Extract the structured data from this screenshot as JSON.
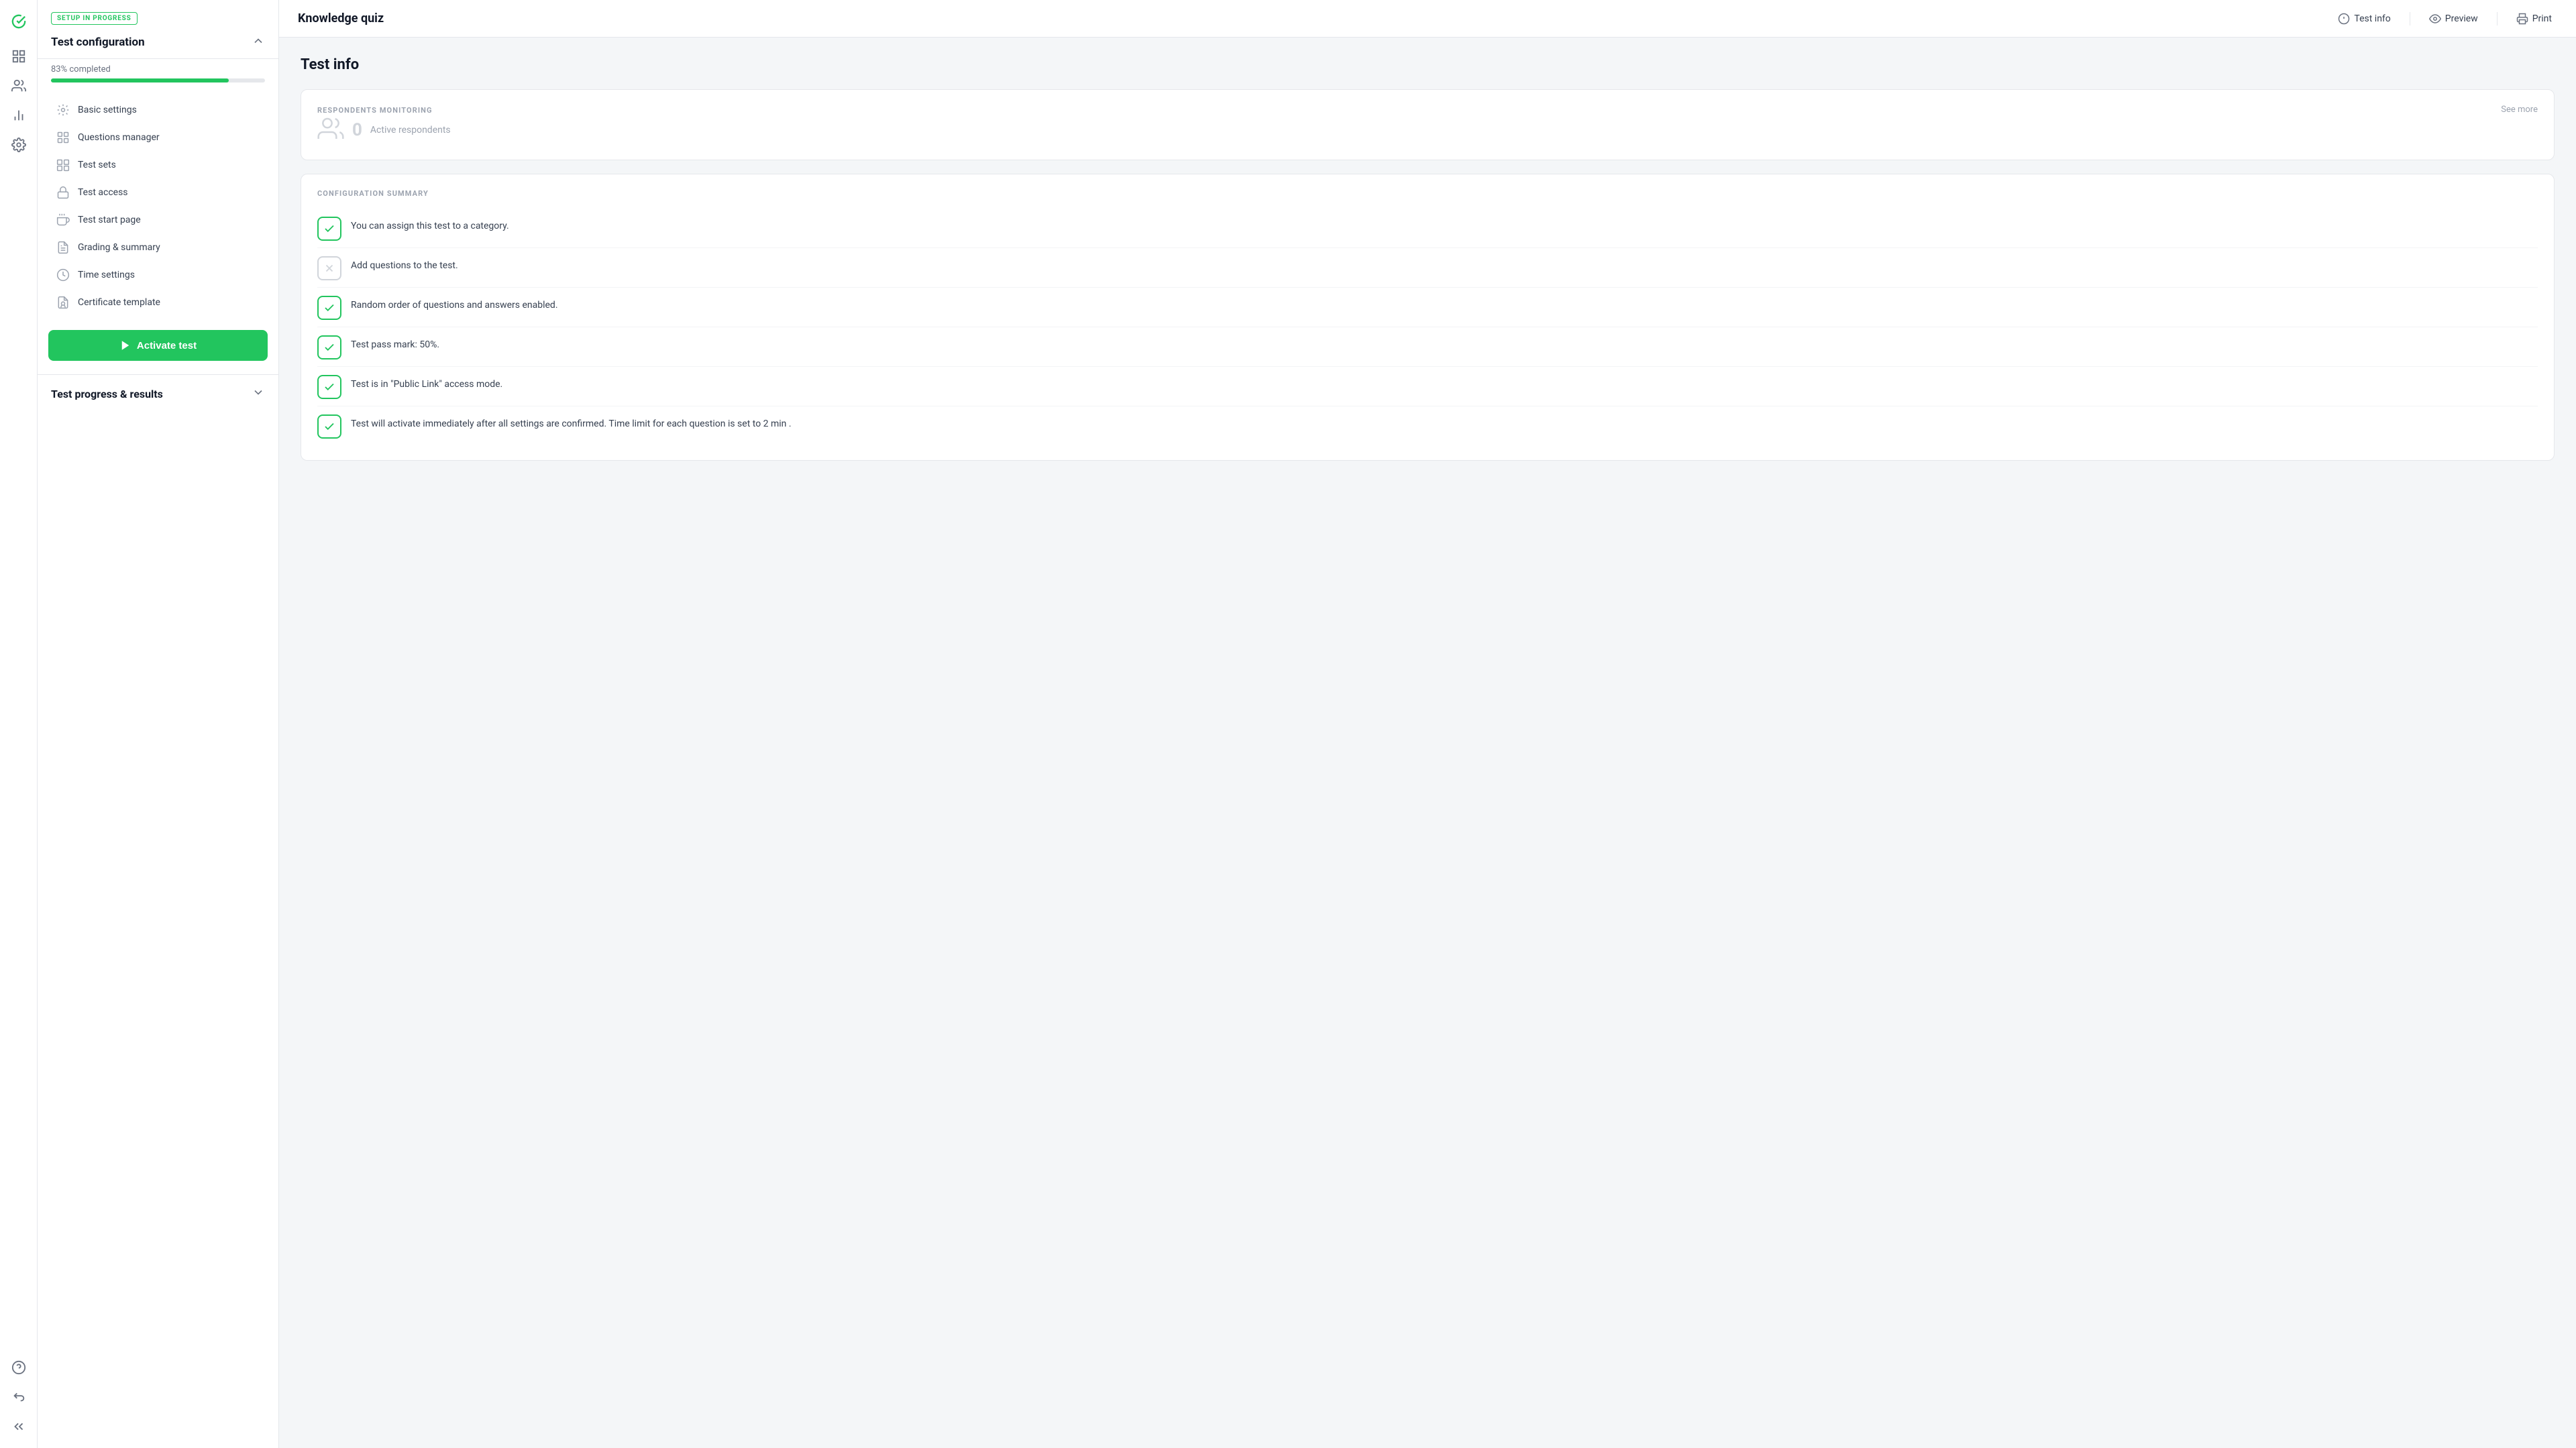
{
  "app": {
    "logo_icon": "check-circle-icon",
    "title": "Knowledge quiz"
  },
  "left_sidebar": {
    "icons": [
      {
        "name": "home-icon",
        "label": "Home",
        "active": true,
        "symbol": "✓"
      },
      {
        "name": "grid-icon",
        "label": "Grid",
        "active": false
      },
      {
        "name": "users-icon",
        "label": "Users",
        "active": false
      },
      {
        "name": "chart-icon",
        "label": "Chart",
        "active": false
      },
      {
        "name": "settings-icon",
        "label": "Settings",
        "active": false
      }
    ],
    "bottom_icons": [
      {
        "name": "help-icon",
        "label": "Help"
      },
      {
        "name": "back-icon",
        "label": "Back"
      },
      {
        "name": "collapse-icon",
        "label": "Collapse"
      }
    ]
  },
  "sidebar": {
    "setup_badge": "SETUP IN PROGRESS",
    "config_title": "Test configuration",
    "progress_label": "83% completed",
    "progress_value": 83,
    "nav_items": [
      {
        "id": "basic-settings",
        "label": "Basic settings",
        "icon": "basic-settings-icon"
      },
      {
        "id": "questions-manager",
        "label": "Questions manager",
        "icon": "questions-icon"
      },
      {
        "id": "test-sets",
        "label": "Test sets",
        "icon": "test-sets-icon"
      },
      {
        "id": "test-access",
        "label": "Test access",
        "icon": "lock-icon"
      },
      {
        "id": "test-start-page",
        "label": "Test start page",
        "icon": "start-page-icon"
      },
      {
        "id": "grading-summary",
        "label": "Grading & summary",
        "icon": "grading-icon"
      },
      {
        "id": "time-settings",
        "label": "Time settings",
        "icon": "time-icon"
      },
      {
        "id": "certificate-template",
        "label": "Certificate template",
        "icon": "certificate-icon"
      }
    ],
    "activate_button": "Activate test",
    "results_title": "Test progress & results"
  },
  "header": {
    "title": "Knowledge quiz",
    "test_info_label": "Test info",
    "preview_label": "Preview",
    "print_label": "Print"
  },
  "main": {
    "page_title": "Test info",
    "respondents_section": {
      "section_title": "RESPONDENTS MONITORING",
      "see_more_label": "See more",
      "count": "0",
      "label": "Active respondents"
    },
    "config_summary": {
      "section_title": "CONFIGURATION SUMMARY",
      "items": [
        {
          "status": "green",
          "text": "You can assign this test to a category."
        },
        {
          "status": "gray",
          "text": "Add questions to the test."
        },
        {
          "status": "green",
          "text": "Random order of questions and answers enabled."
        },
        {
          "status": "green",
          "text": "Test pass mark: 50%."
        },
        {
          "status": "green",
          "text": "Test is in \"Public Link\" access mode."
        },
        {
          "status": "green",
          "text": "Test will activate immediately after all settings are confirmed. Time limit for each question is set to 2 min ."
        }
      ]
    }
  }
}
